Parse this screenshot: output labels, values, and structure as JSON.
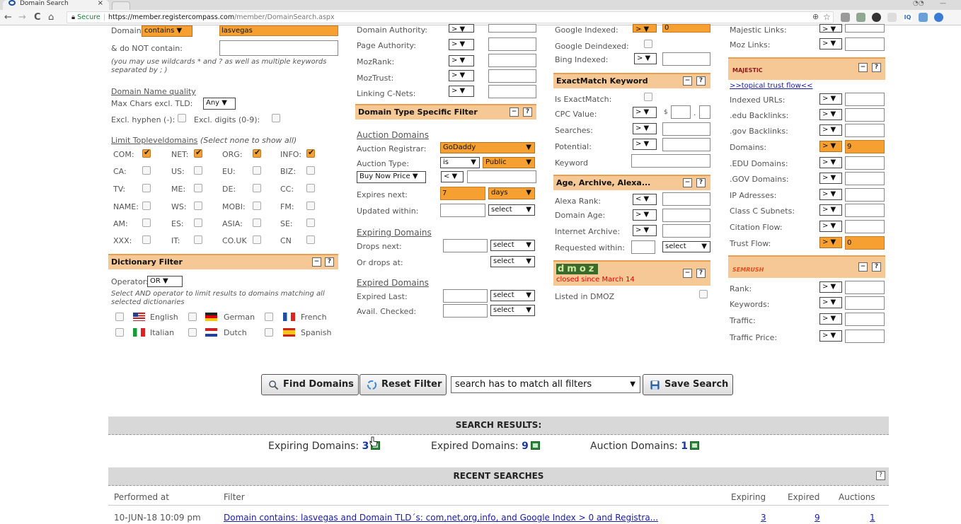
{
  "browser": {
    "tab_title": "Domain Search",
    "tab_close": "×",
    "nav_back": "←",
    "nav_forward": "→",
    "nav_reload": "C",
    "nav_home": "⌂",
    "secure_label": "Secure",
    "url_host": "https://member.registercompass.com",
    "url_path": "/member/DomainSearch.aspx",
    "search_icon": "⊕",
    "star_icon": "☆"
  },
  "col1": {
    "domain_label": "Domain",
    "domain_mode": "contains",
    "domain_value": "lasvegas",
    "donot_label": "& do NOT contain:",
    "donot_value": "",
    "wildcard_note": "(you may use wildcards * and ? as well as multiple keywords separated by ; )",
    "quality_title": "Domain Name quality",
    "maxchars_label": "Max Chars excl. TLD:",
    "maxchars_value": "Any",
    "excl_hyphen": "Excl. hyphen (-):",
    "excl_digits": "Excl. digits (0-9):",
    "tld_title": "Limit Topleveldomains",
    "tld_note": "(Select none to show all)",
    "tlds": [
      {
        "l": "COM:",
        "on": true
      },
      {
        "l": "NET:",
        "on": true
      },
      {
        "l": "ORG:",
        "on": true
      },
      {
        "l": "INFO:",
        "on": true
      },
      {
        "l": "CA:",
        "on": false
      },
      {
        "l": "US:",
        "on": false
      },
      {
        "l": "EU:",
        "on": false
      },
      {
        "l": "BIZ:",
        "on": false
      },
      {
        "l": "TV:",
        "on": false
      },
      {
        "l": "ME:",
        "on": false
      },
      {
        "l": "DE:",
        "on": false
      },
      {
        "l": "CC:",
        "on": false
      },
      {
        "l": "NAME:",
        "on": false
      },
      {
        "l": "WS:",
        "on": false
      },
      {
        "l": "MOBI:",
        "on": false
      },
      {
        "l": "FM:",
        "on": false
      },
      {
        "l": "AM:",
        "on": false
      },
      {
        "l": "ES:",
        "on": false
      },
      {
        "l": "ASIA:",
        "on": false
      },
      {
        "l": "SE:",
        "on": false
      },
      {
        "l": "XXX:",
        "on": false
      },
      {
        "l": "IT:",
        "on": false
      },
      {
        "l": "CO.UK",
        "on": false
      },
      {
        "l": "CN",
        "on": false
      }
    ],
    "dict_header": "Dictionary Filter",
    "operator_label": "Operator:",
    "operator_value": "OR",
    "dict_note": "Select AND operator to limit results to domains matching all selected dictionaries",
    "dicts": [
      "English",
      "German",
      "French",
      "Italian",
      "Dutch",
      "Spanish"
    ]
  },
  "col2": {
    "domain_authority": "Domain Authority:",
    "page_authority": "Page Authority:",
    "mozrank": "MozRank:",
    "moztrust": "MozTrust:",
    "linking_cnets": "Linking C-Nets:",
    "op_gt": "> ▼",
    "op_lt": "< ▼",
    "dtype_header": "Domain Type Specific Filter",
    "auction_title": "Auction Domains",
    "auction_registrar": "Auction Registrar:",
    "auction_registrar_value": "GoDaddy",
    "auction_type": "Auction Type:",
    "auction_type_op": "is",
    "auction_type_value": "Public",
    "buy_now": "Buy Now Price",
    "expires_next": "Expires next:",
    "expires_value": "7",
    "expires_unit": "days",
    "updated_within": "Updated within:",
    "select": "select",
    "expiring_title": "Expiring Domains",
    "drops_next": "Drops next:",
    "drops_at": "Or drops at:",
    "expired_title": "Expired Domains",
    "expired_last": "Expired Last:",
    "avail_checked": "Avail. Checked:"
  },
  "col3": {
    "google_indexed": "Google Indexed:",
    "google_indexed_value": "0",
    "google_deindexed": "Google Deindexed:",
    "bing_indexed": "Bing Indexed:",
    "exact_header": "ExactMatch Keyword",
    "is_exact": "Is ExactMatch:",
    "cpc": "CPC Value:",
    "cpc_currency": "$",
    "cpc_dot": ".",
    "searches": "Searches:",
    "potential": "Potential:",
    "keyword": "Keyword",
    "age_header": "Age, Archive, Alexa...",
    "alexa": "Alexa Rank:",
    "domain_age": "Domain Age:",
    "archive": "Internet Archive:",
    "requested": "Requested within:",
    "dmoz_logo": "dmoz",
    "dmoz_note": "closed since March 14",
    "listed_dmoz": "Listed in DMOZ"
  },
  "col4": {
    "majestic_links": "Majestic Links:",
    "moz_links": "Moz Links:",
    "majestic_logo": "MAJESTIC",
    "topical_link": ">>topical trust flow<<",
    "rows": [
      {
        "l": "Indexed URLs:",
        "v": "",
        "o": false
      },
      {
        "l": ".edu Backlinks:",
        "v": "",
        "o": false
      },
      {
        "l": ".gov Backlinks:",
        "v": "",
        "o": false
      },
      {
        "l": "Domains:",
        "v": "9",
        "o": true
      },
      {
        "l": ".EDU Domains:",
        "v": "",
        "o": false
      },
      {
        "l": ".GOV Domains:",
        "v": "",
        "o": false
      },
      {
        "l": "IP Adresses:",
        "v": "",
        "o": false
      },
      {
        "l": "Class C Subnets:",
        "v": "",
        "o": false
      },
      {
        "l": "Citation Flow:",
        "v": "",
        "o": false
      },
      {
        "l": "Trust Flow:",
        "v": "0",
        "o": true
      }
    ],
    "semrush_logo": "SEMRUSH",
    "sem_rows": [
      "Rank:",
      "Keywords:",
      "Traffic:",
      "Traffic Price:"
    ]
  },
  "actions": {
    "find": "Find Domains",
    "reset": "Reset Filter",
    "match": "search has to match all filters",
    "save": "Save Search"
  },
  "results": {
    "title": "SEARCH RESULTS:",
    "expiring_label": "Expiring Domains:",
    "expiring_count": "3",
    "expired_label": "Expired Domains:",
    "expired_count": "9",
    "auction_label": "Auction Domains:",
    "auction_count": "1"
  },
  "recent": {
    "title": "RECENT SEARCHES",
    "help": "?",
    "col_performed": "Performed at",
    "col_filter": "Filter",
    "col_expiring": "Expiring",
    "col_expired": "Expired",
    "col_auctions": "Auctions",
    "rows": [
      {
        "date": "10-JUN-18 10:09 pm",
        "filter": "Domain contains: lasvegas and Domain TLD´s: com,net,org,info, and Google Index > 0 and Registra...",
        "expiring": "3",
        "expired": "9",
        "auctions": "1"
      }
    ]
  },
  "colors": {
    "orange": "#f5a030",
    "header": "#f5c896",
    "link": "#1a1aaa",
    "count": "#1a3aa0"
  }
}
